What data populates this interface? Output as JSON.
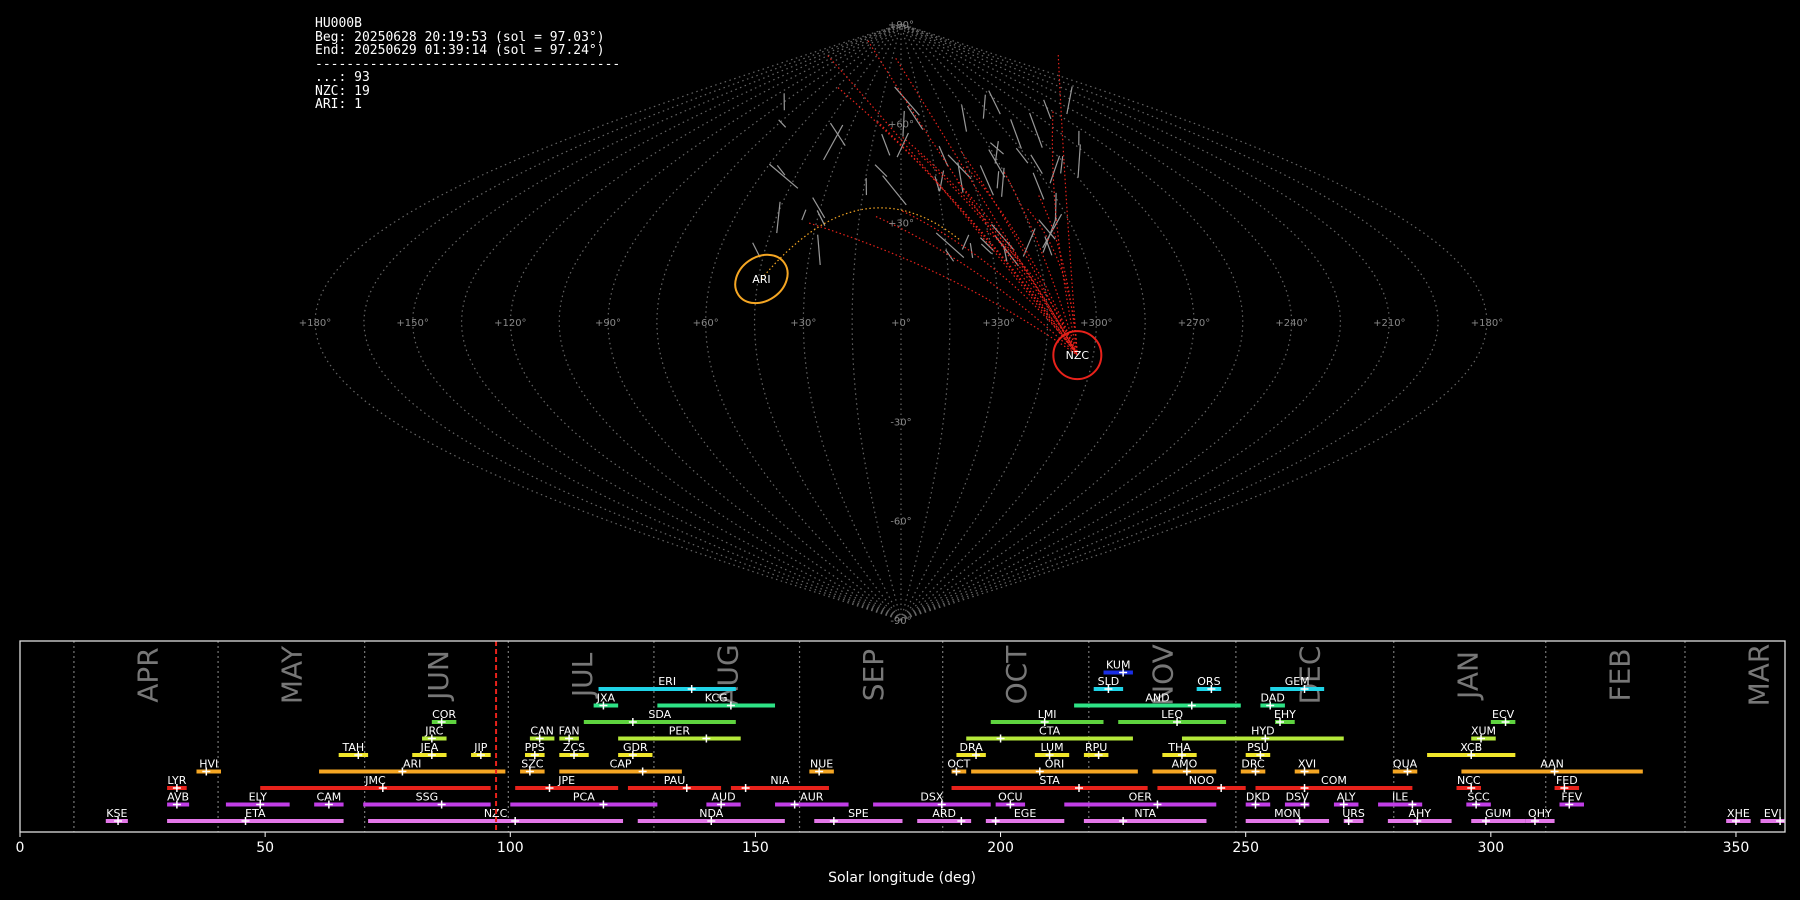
{
  "station": "HU000B",
  "beg": "Beg: 20250628 20:19:53 (sol = 97.03°)",
  "end": "End: 20250629 01:39:14 (sol = 97.24°)",
  "separator": "---------------------------------------",
  "counts": [
    {
      "code": "...",
      "n": 93
    },
    {
      "code": "NZC",
      "n": 19
    },
    {
      "code": "ARI",
      "n": 1
    }
  ],
  "sky_map": {
    "projection": "sinusoidal",
    "lon_labels": [
      "+180°",
      "+150°",
      "+120°",
      "+90°",
      "+60°",
      "+30°",
      "+0°",
      "+330°",
      "+300°",
      "+270°",
      "+240°",
      "+210°",
      "+180°"
    ],
    "lat_labels": [
      "+90°",
      "+60°",
      "+30°",
      "-30°",
      "-60°",
      "-90°"
    ],
    "radiants": [
      {
        "code": "ARI",
        "lon": 44,
        "lat": 13,
        "color": "#f5a623"
      },
      {
        "code": "NZC",
        "lon": 305,
        "lat": -10,
        "color": "#e8221b"
      }
    ]
  },
  "chart_data": {
    "type": "timeline",
    "xlabel": "Solar longitude (deg)",
    "xlim": [
      0,
      360
    ],
    "xticks": [
      0,
      50,
      100,
      150,
      200,
      250,
      300,
      350
    ],
    "current_sol": 97.1,
    "months": [
      {
        "name": "APR",
        "start": 11.0,
        "end": 40.4
      },
      {
        "name": "MAY",
        "start": 40.4,
        "end": 70.3
      },
      {
        "name": "JUN",
        "start": 70.3,
        "end": 99.6
      },
      {
        "name": "JUL",
        "start": 99.6,
        "end": 129.3
      },
      {
        "name": "AUG",
        "start": 129.3,
        "end": 159.0
      },
      {
        "name": "SEP",
        "start": 159.0,
        "end": 188.2
      },
      {
        "name": "OCT",
        "start": 188.2,
        "end": 248.0
      },
      {
        "name": "NOV",
        "start": 218.0,
        "end": 248.0
      },
      {
        "name": "DEC",
        "start": 248.0,
        "end": 280.2
      },
      {
        "name": "JAN",
        "start": 280.2,
        "end": 311.2
      },
      {
        "name": "FEB",
        "start": 311.2,
        "end": 339.6
      },
      {
        "name": "MAR",
        "start": 339.6,
        "end": 370.0
      }
    ],
    "month_dividers": [
      11.0,
      40.4,
      70.3,
      99.6,
      129.3,
      159.0,
      188.2,
      218.0,
      248.0,
      280.2,
      311.2,
      339.6
    ],
    "showers": [
      {
        "code": "KSE",
        "start": 17.5,
        "end": 22,
        "peak": 20,
        "row": 0,
        "color": "#e377e8"
      },
      {
        "code": "ETA",
        "start": 30,
        "end": 66,
        "peak": 46,
        "row": 0,
        "color": "#e377e8"
      },
      {
        "code": "NZC",
        "start": 71,
        "end": 123,
        "peak": 101,
        "row": 0,
        "color": "#e377e8"
      },
      {
        "code": "NDA",
        "start": 126,
        "end": 156,
        "peak": 141,
        "row": 0,
        "color": "#e377e8"
      },
      {
        "code": "SPE",
        "start": 162,
        "end": 180,
        "peak": 166,
        "row": 0,
        "color": "#e377e8"
      },
      {
        "code": "ARD",
        "start": 183,
        "end": 194,
        "peak": 192,
        "row": 0,
        "color": "#e377e8"
      },
      {
        "code": "EGE",
        "start": 197,
        "end": 213,
        "peak": 199,
        "row": 0,
        "color": "#e377e8"
      },
      {
        "code": "NTA",
        "start": 217,
        "end": 242,
        "peak": 225,
        "row": 0,
        "color": "#e377e8"
      },
      {
        "code": "MON",
        "start": 250,
        "end": 267,
        "peak": 261,
        "row": 0,
        "color": "#e377e8"
      },
      {
        "code": "URS",
        "start": 270,
        "end": 274,
        "peak": 271,
        "row": 0,
        "color": "#e377e8"
      },
      {
        "code": "AHY",
        "start": 279,
        "end": 292,
        "peak": 285,
        "row": 0,
        "color": "#e377e8"
      },
      {
        "code": "GUM",
        "start": 296,
        "end": 307,
        "peak": 299,
        "row": 0,
        "color": "#e377e8"
      },
      {
        "code": "OHY",
        "start": 307,
        "end": 313,
        "peak": 309,
        "row": 0,
        "color": "#e377e8"
      },
      {
        "code": "XHE",
        "start": 348,
        "end": 353,
        "peak": 350,
        "row": 0,
        "color": "#e377e8"
      },
      {
        "code": "EVI",
        "start": 355,
        "end": 360,
        "peak": 359,
        "row": 0,
        "color": "#e377e8"
      },
      {
        "code": "AVB",
        "start": 30,
        "end": 34.5,
        "peak": 32,
        "row": 1,
        "color": "#c13ee6"
      },
      {
        "code": "ELY",
        "start": 42,
        "end": 55,
        "peak": 49,
        "row": 1,
        "color": "#c13ee6"
      },
      {
        "code": "CAM",
        "start": 60,
        "end": 66,
        "peak": 63,
        "row": 1,
        "color": "#c13ee6"
      },
      {
        "code": "SSG",
        "start": 70,
        "end": 96,
        "peak": 86,
        "row": 1,
        "color": "#c13ee6"
      },
      {
        "code": "PCA",
        "start": 100,
        "end": 130,
        "peak": 119,
        "row": 1,
        "color": "#c13ee6"
      },
      {
        "code": "AUD",
        "start": 140,
        "end": 147,
        "peak": 143,
        "row": 1,
        "color": "#c13ee6"
      },
      {
        "code": "AUR",
        "start": 154,
        "end": 169,
        "peak": 158,
        "row": 1,
        "color": "#c13ee6"
      },
      {
        "code": "DSX",
        "start": 174,
        "end": 198,
        "peak": 188,
        "row": 1,
        "color": "#c13ee6"
      },
      {
        "code": "OCU",
        "start": 199,
        "end": 205,
        "peak": 202,
        "row": 1,
        "color": "#c13ee6"
      },
      {
        "code": "OER",
        "start": 213,
        "end": 244,
        "peak": 232,
        "row": 1,
        "color": "#c13ee6"
      },
      {
        "code": "DKD",
        "start": 250,
        "end": 255,
        "peak": 252,
        "row": 1,
        "color": "#c13ee6"
      },
      {
        "code": "DSV",
        "start": 258,
        "end": 263,
        "peak": 262,
        "row": 1,
        "color": "#c13ee6"
      },
      {
        "code": "ALY",
        "start": 268,
        "end": 273,
        "peak": 270,
        "row": 1,
        "color": "#c13ee6"
      },
      {
        "code": "ILE",
        "start": 277,
        "end": 286,
        "peak": 284,
        "row": 1,
        "color": "#c13ee6"
      },
      {
        "code": "SCC",
        "start": 295,
        "end": 300,
        "peak": 297,
        "row": 1,
        "color": "#c13ee6"
      },
      {
        "code": "FEV",
        "start": 314,
        "end": 319,
        "peak": 316,
        "row": 1,
        "color": "#c13ee6"
      },
      {
        "code": "LYR",
        "start": 30,
        "end": 34,
        "peak": 32,
        "row": 2,
        "color": "#e8221b"
      },
      {
        "code": "JMC",
        "start": 49,
        "end": 96,
        "peak": 74,
        "row": 2,
        "color": "#e8221b"
      },
      {
        "code": "JPE",
        "start": 101,
        "end": 122,
        "peak": 108,
        "row": 2,
        "color": "#e8221b"
      },
      {
        "code": "PAU",
        "start": 124,
        "end": 143,
        "peak": 136,
        "row": 2,
        "color": "#e8221b"
      },
      {
        "code": "NIA",
        "start": 145,
        "end": 165,
        "peak": 148,
        "row": 2,
        "color": "#e8221b"
      },
      {
        "code": "STA",
        "start": 190,
        "end": 230,
        "peak": 216,
        "row": 2,
        "color": "#e8221b"
      },
      {
        "code": "NOO",
        "start": 232,
        "end": 250,
        "peak": 245,
        "row": 2,
        "color": "#e8221b"
      },
      {
        "code": "COM",
        "start": 252,
        "end": 284,
        "peak": 262,
        "row": 2,
        "color": "#e8221b"
      },
      {
        "code": "NCC",
        "start": 293,
        "end": 298,
        "peak": 296,
        "row": 2,
        "color": "#e8221b"
      },
      {
        "code": "FED",
        "start": 313,
        "end": 318,
        "peak": 315,
        "row": 2,
        "color": "#e8221b"
      },
      {
        "code": "HVI",
        "start": 36,
        "end": 41,
        "peak": 38,
        "row": 3,
        "color": "#f5a623"
      },
      {
        "code": "ARI",
        "start": 61,
        "end": 99,
        "peak": 78,
        "row": 3,
        "color": "#f5a623"
      },
      {
        "code": "SZC",
        "start": 102,
        "end": 107,
        "peak": 104,
        "row": 3,
        "color": "#f5a623"
      },
      {
        "code": "CAP",
        "start": 110,
        "end": 135,
        "peak": 127,
        "row": 3,
        "color": "#f5a623"
      },
      {
        "code": "NUE",
        "start": 161,
        "end": 166,
        "peak": 163,
        "row": 3,
        "color": "#f5a623"
      },
      {
        "code": "OCT",
        "start": 190,
        "end": 193,
        "peak": 191,
        "row": 3,
        "color": "#f5a623"
      },
      {
        "code": "ORI",
        "start": 194,
        "end": 228,
        "peak": 208,
        "row": 3,
        "color": "#f5a623"
      },
      {
        "code": "AMO",
        "start": 231,
        "end": 244,
        "peak": 238,
        "row": 3,
        "color": "#f5a623"
      },
      {
        "code": "DRC",
        "start": 249,
        "end": 254,
        "peak": 252,
        "row": 3,
        "color": "#f5a623"
      },
      {
        "code": "XVI",
        "start": 260,
        "end": 265,
        "peak": 262,
        "row": 3,
        "color": "#f5a623"
      },
      {
        "code": "QUA",
        "start": 280,
        "end": 285,
        "peak": 283,
        "row": 3,
        "color": "#f5a623"
      },
      {
        "code": "AAN",
        "start": 294,
        "end": 331,
        "peak": 313,
        "row": 3,
        "color": "#f5a623"
      },
      {
        "code": "TAH",
        "start": 65,
        "end": 71,
        "peak": 69,
        "row": 4,
        "color": "#f0e62a"
      },
      {
        "code": "JEA",
        "start": 80,
        "end": 87,
        "peak": 84,
        "row": 4,
        "color": "#f0e62a"
      },
      {
        "code": "JIP",
        "start": 92,
        "end": 96,
        "peak": 94,
        "row": 4,
        "color": "#f0e62a"
      },
      {
        "code": "PPS",
        "start": 103,
        "end": 107,
        "peak": 105,
        "row": 4,
        "color": "#f0e62a"
      },
      {
        "code": "ZCS",
        "start": 110,
        "end": 116,
        "peak": 113,
        "row": 4,
        "color": "#f0e62a"
      },
      {
        "code": "GDR",
        "start": 122,
        "end": 129,
        "peak": 125,
        "row": 4,
        "color": "#f0e62a"
      },
      {
        "code": "DRA",
        "start": 191,
        "end": 197,
        "peak": 195,
        "row": 4,
        "color": "#f0e62a"
      },
      {
        "code": "LUM",
        "start": 207,
        "end": 214,
        "peak": 210,
        "row": 4,
        "color": "#f0e62a"
      },
      {
        "code": "RPU",
        "start": 217,
        "end": 222,
        "peak": 220,
        "row": 4,
        "color": "#f0e62a"
      },
      {
        "code": "THA",
        "start": 233,
        "end": 240,
        "peak": 237,
        "row": 4,
        "color": "#f0e62a"
      },
      {
        "code": "PSU",
        "start": 250,
        "end": 255,
        "peak": 253,
        "row": 4,
        "color": "#f0e62a"
      },
      {
        "code": "XCB",
        "start": 287,
        "end": 305,
        "peak": 296,
        "row": 4,
        "color": "#f0e62a"
      },
      {
        "code": "JRC",
        "start": 82,
        "end": 87,
        "peak": 84,
        "row": 5,
        "color": "#b5e93a"
      },
      {
        "code": "CAN",
        "start": 104,
        "end": 109,
        "peak": 106,
        "row": 5,
        "color": "#b5e93a"
      },
      {
        "code": "FAN",
        "start": 110,
        "end": 114,
        "peak": 112,
        "row": 5,
        "color": "#b5e93a"
      },
      {
        "code": "PER",
        "start": 122,
        "end": 147,
        "peak": 140,
        "row": 5,
        "color": "#b5e93a"
      },
      {
        "code": "CTA",
        "start": 193,
        "end": 227,
        "peak": 200,
        "row": 5,
        "color": "#b5e93a"
      },
      {
        "code": "HYD",
        "start": 237,
        "end": 270,
        "peak": 254,
        "row": 5,
        "color": "#b5e93a"
      },
      {
        "code": "XUM",
        "start": 296,
        "end": 301,
        "peak": 298,
        "row": 5,
        "color": "#b5e93a"
      },
      {
        "code": "COR",
        "start": 84,
        "end": 89,
        "peak": 86,
        "row": 6,
        "color": "#5ed33f"
      },
      {
        "code": "SDA",
        "start": 115,
        "end": 146,
        "peak": 125,
        "row": 6,
        "color": "#5ed33f"
      },
      {
        "code": "LMI",
        "start": 198,
        "end": 221,
        "peak": 209,
        "row": 6,
        "color": "#5ed33f"
      },
      {
        "code": "LEQ",
        "start": 224,
        "end": 246,
        "peak": 236,
        "row": 6,
        "color": "#5ed33f"
      },
      {
        "code": "EHY",
        "start": 256,
        "end": 260,
        "peak": 257,
        "row": 6,
        "color": "#5ed33f"
      },
      {
        "code": "ECV",
        "start": 300,
        "end": 305,
        "peak": 303,
        "row": 6,
        "color": "#5ed33f"
      },
      {
        "code": "JXA",
        "start": 117,
        "end": 122,
        "peak": 119,
        "row": 7,
        "color": "#2ee386"
      },
      {
        "code": "KCG",
        "start": 130,
        "end": 154,
        "peak": 145,
        "row": 7,
        "color": "#2ee386"
      },
      {
        "code": "AND",
        "start": 215,
        "end": 249,
        "peak": 239,
        "row": 7,
        "color": "#2ee386"
      },
      {
        "code": "DAD",
        "start": 253,
        "end": 258,
        "peak": 255,
        "row": 7,
        "color": "#2ee386"
      },
      {
        "code": "ERI",
        "start": 118,
        "end": 146,
        "peak": 137,
        "row": 8,
        "color": "#1fd3e6"
      },
      {
        "code": "SLD",
        "start": 219,
        "end": 225,
        "peak": 222,
        "row": 8,
        "color": "#1fd3e6"
      },
      {
        "code": "ORS",
        "start": 240,
        "end": 245,
        "peak": 243,
        "row": 8,
        "color": "#1fd3e6"
      },
      {
        "code": "GEM",
        "start": 255,
        "end": 266,
        "peak": 262,
        "row": 8,
        "color": "#1fd3e6"
      },
      {
        "code": "KUM",
        "start": 221,
        "end": 227,
        "peak": 225,
        "row": 9,
        "color": "#1a2ee6"
      }
    ]
  }
}
